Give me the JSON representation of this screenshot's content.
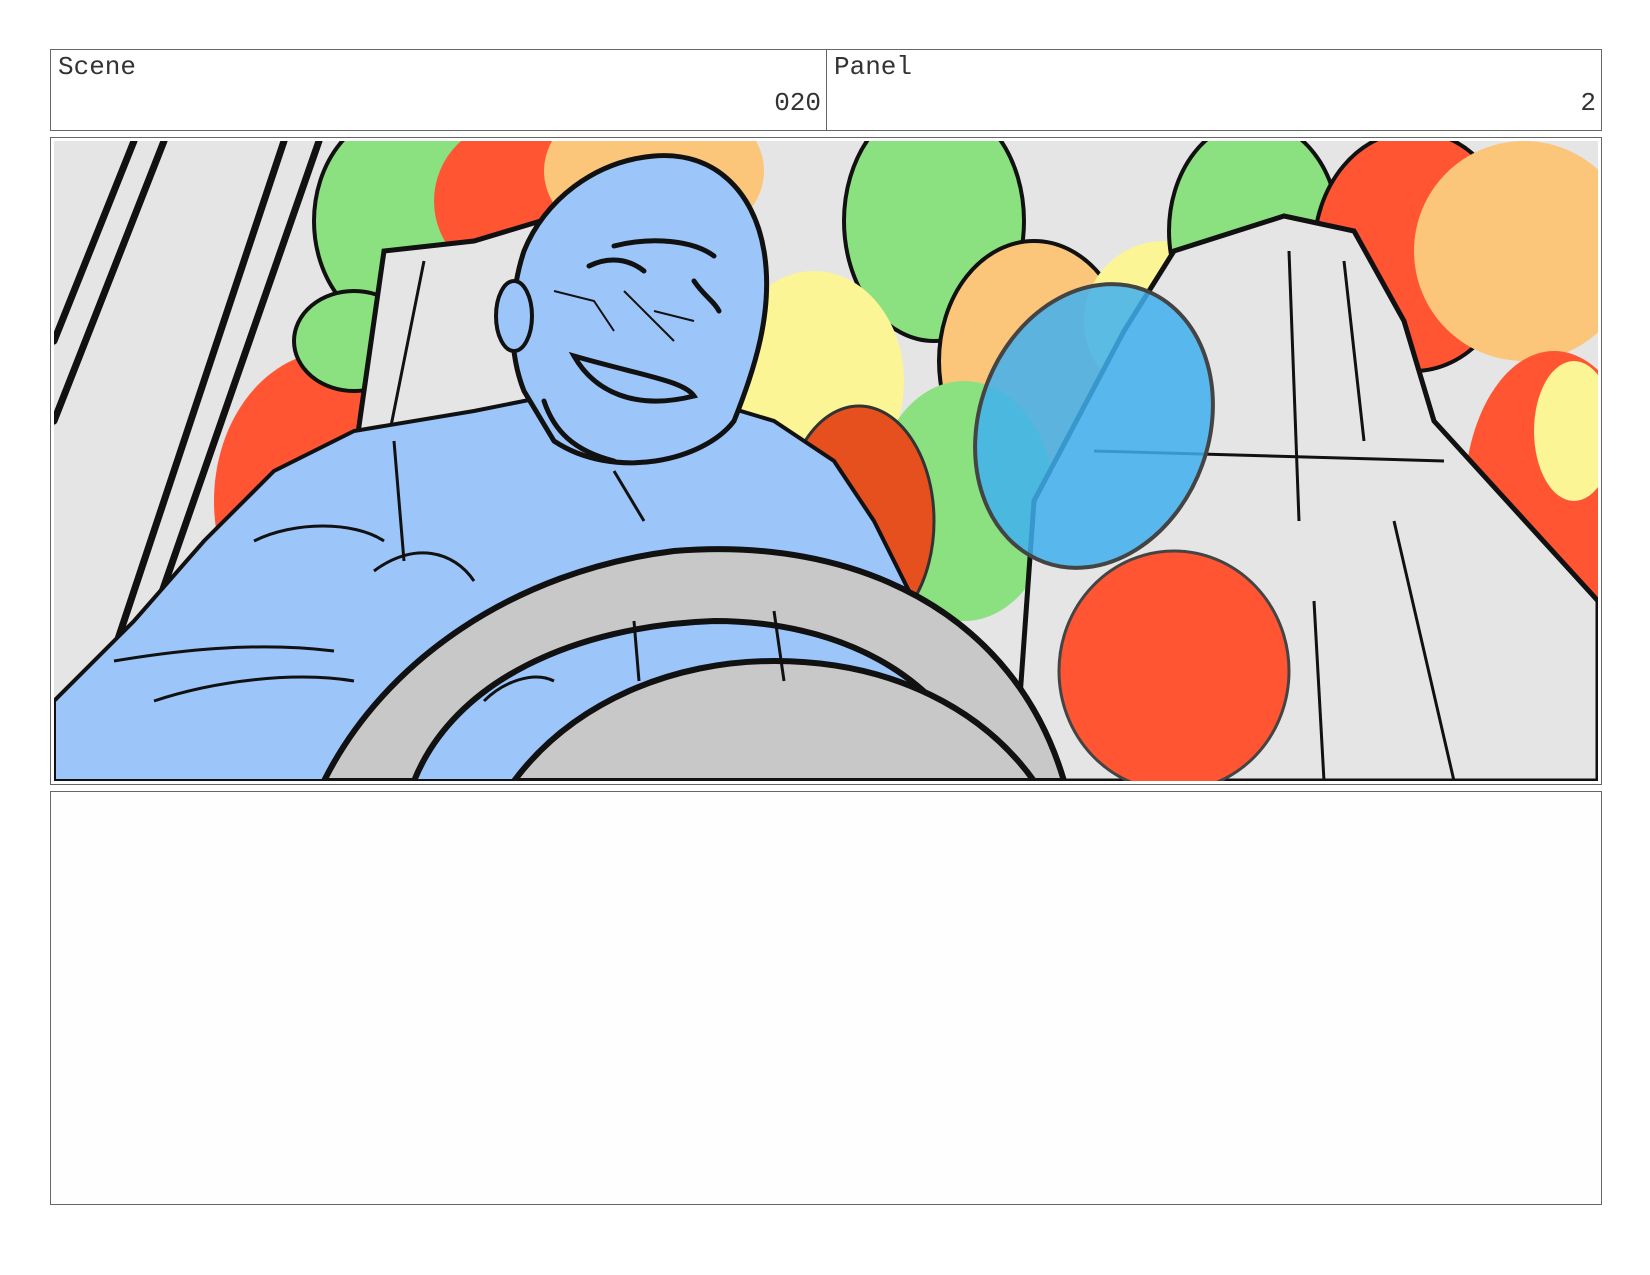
{
  "header": {
    "scene_label": "Scene",
    "scene_value": "020",
    "panel_label": "Panel",
    "panel_value": "2"
  },
  "notes": {
    "text": ""
  }
}
